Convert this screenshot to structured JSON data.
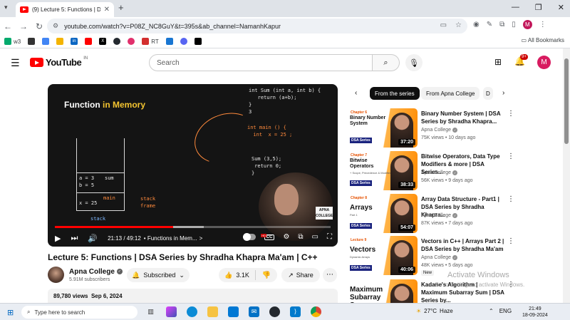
{
  "browser": {
    "tab_title": "(9) Lecture 5: Functions | DSA Se",
    "tab_close": "✕",
    "new_tab": "+",
    "url": "youtube.com/watch?v=P08Z_NC8GuY&t=395s&ab_channel=NamanhKapur",
    "bookmarks": [
      "w3",
      "",
      "",
      "",
      "in",
      "",
      "X",
      "",
      "",
      "RT",
      "",
      "",
      ""
    ],
    "all_bookmarks": "All Bookmarks",
    "profile_initial": "M"
  },
  "youtube": {
    "logo_text": "YouTube",
    "region": "IN",
    "search_placeholder": "Search",
    "notification_count": "9+",
    "avatar_initial": "M"
  },
  "player": {
    "board_title_1": "Function ",
    "board_title_2": "in Memory",
    "code_right": "int Sum (int a, int b) {\n   return (a+b);\n}\n3",
    "code_main": "int main () {\n  int  x = 25 ;",
    "code_call": "Sum (3,5);\n return 0;\n}",
    "stack_vals": "a = 3\nb = 5",
    "stack_sum": "sum",
    "stack_main": "main",
    "stack_x": "x = 25",
    "stack_label": "stack",
    "stack_frame": "stack\nframe",
    "watermark": "APNA\nCOLLEGE",
    "time": "21:13 / 49:12",
    "chapter": "• Functions in Mem...",
    "chapter_arrow": ">",
    "progress_pct": 43,
    "buffer_pct": 54,
    "hd_label": "HD"
  },
  "video": {
    "title": "Lecture 5: Functions | DSA Series by Shradha Khapra Ma'am | C++",
    "channel": "Apna College",
    "subscribers": "5.91M subscribers",
    "subscribed_label": "Subscribed",
    "likes": "3.1K",
    "share_label": "Share",
    "views": "89,780 views",
    "date": "Sep 6, 2024"
  },
  "chips": [
    "From the series",
    "From Apna College",
    "D"
  ],
  "recommendations": [
    {
      "chapter": "Chapter 6",
      "topic": "Binary Number System",
      "title": "Binary Number System | DSA Series by Shradha Khapra...",
      "channel": "Apna College",
      "views": "75K views",
      "age": "10 days ago",
      "duration": "37:20",
      "new": ""
    },
    {
      "chapter": "Chapter 7",
      "topic": "Bitwise Operators",
      "sub": "+ Scope, Precedence & Modifiers",
      "title": "Bitwise Operators, Data Type Modifiers & more | DSA Series...",
      "channel": "Apna College",
      "views": "56K views",
      "age": "9 days ago",
      "duration": "38:33",
      "new": ""
    },
    {
      "chapter": "Chapter 8",
      "topic": "Arrays",
      "sub": "Part 1",
      "title": "Array Data Structure - Part1 | DSA Series by Shradha Khapra...",
      "channel": "Apna College",
      "views": "87K views",
      "age": "7 days ago",
      "duration": "54:07",
      "new": ""
    },
    {
      "chapter": "Lecture 9",
      "topic": "Vectors",
      "sub": "Dynamic Arrays",
      "title": "Vectors in C++ | Arrays Part 2 | DSA Series by Shradha Ma'am",
      "channel": "Apna College",
      "views": "48K views",
      "age": "5 days ago",
      "duration": "40:06",
      "new": "New"
    },
    {
      "chapter": "",
      "topic": "Maximum Subarray Sum",
      "title": "Kadane's Algorithm | Maximum Subarray Sum | DSA Series by...",
      "channel": "",
      "views": "",
      "age": "",
      "duration": "",
      "new": ""
    }
  ],
  "series_badge": "DSA Series",
  "windows": {
    "activate_title": "Activate Windows",
    "activate_sub": "Go to Settings to activate Windows.",
    "search_placeholder": "Type here to search",
    "temp": "27°C",
    "weather": "Haze",
    "lang": "ENG",
    "time": "21:49",
    "date": "18-09-2024"
  }
}
